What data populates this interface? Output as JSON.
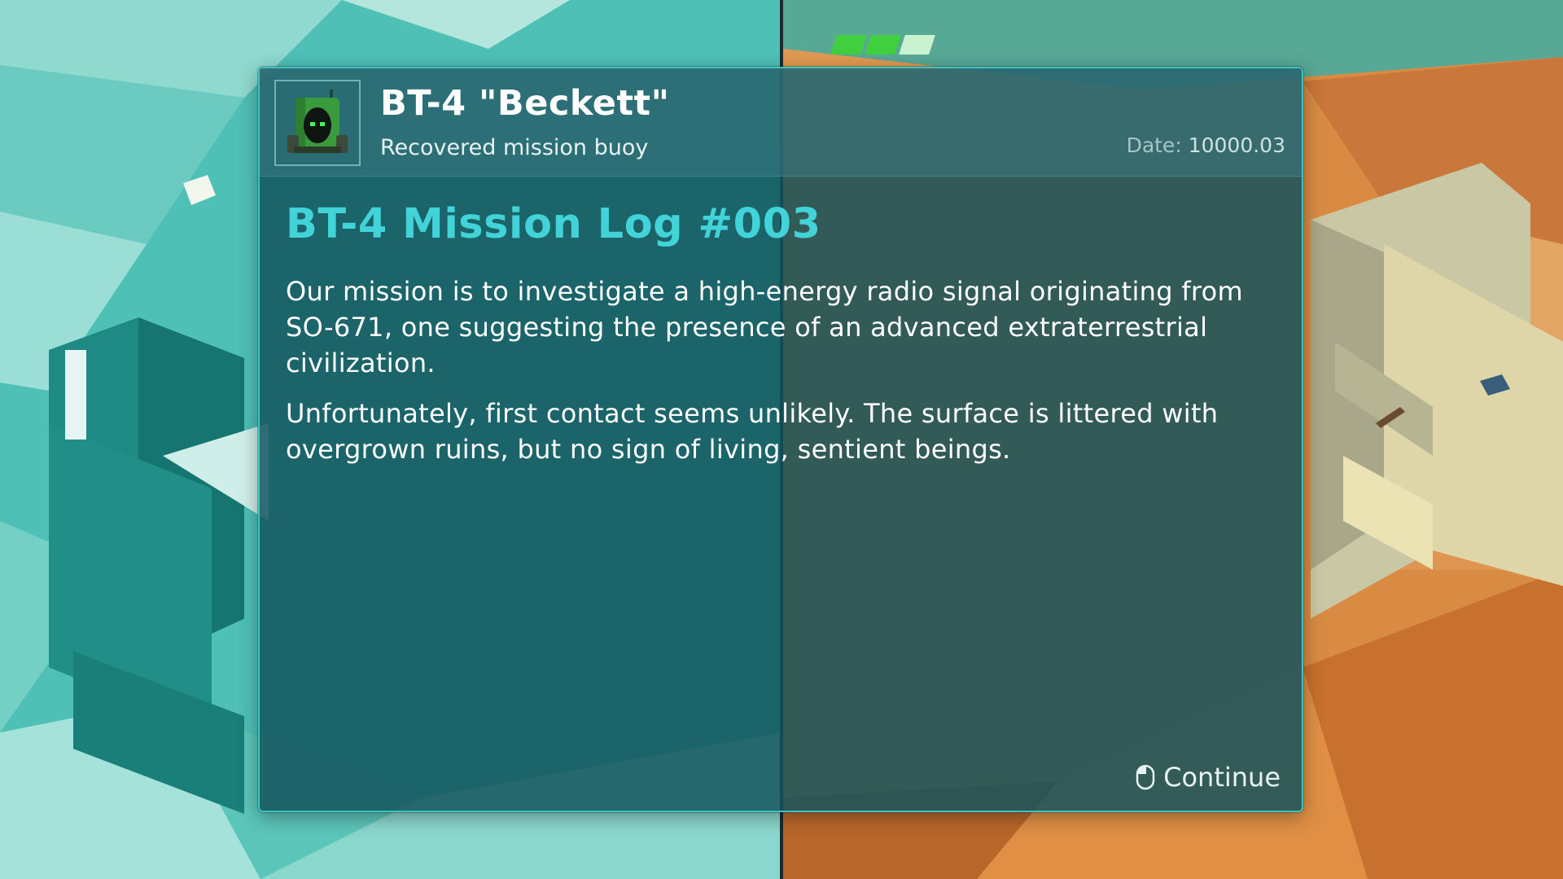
{
  "hud": {
    "energy_cells": {
      "total": 3,
      "filled": 2,
      "fill_color": "#3fcf3f",
      "empty_color": "#c9f2cf"
    }
  },
  "dialog": {
    "portrait_icon": "robot-icon",
    "character_name": "BT-4 \"Beckett\"",
    "character_subtitle": "Recovered mission buoy",
    "date_label": "Date:",
    "date_value": "10000.03",
    "log_title": "BT-4 Mission Log #003",
    "paragraphs": [
      "Our mission is to investigate a high-energy radio signal originating from SO-671, one suggesting the presence of an advanced extraterrestrial civilization.",
      "Unfortunately, first contact seems unlikely. The surface is littered with overgrown ruins, but no sign of living, sentient beings."
    ],
    "continue_icon": "mouse-left-click-icon",
    "continue_label": "Continue"
  },
  "colors": {
    "accent_title": "#41d3d8",
    "panel_border": "#3fc3c3",
    "world_left": "#3bb0a8",
    "world_right": "#d9893f"
  }
}
